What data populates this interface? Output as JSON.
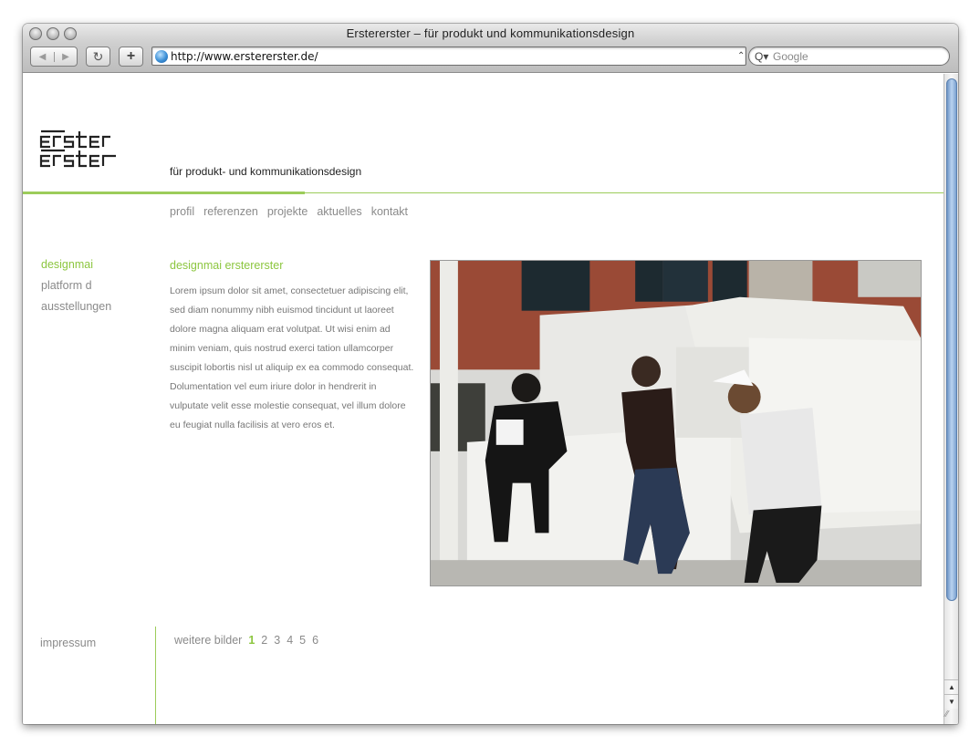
{
  "browser": {
    "window_title": "Erstererster – für produkt und kommunikationsdesign",
    "url": "http://www.erstererster.de/",
    "search_placeholder": "Google",
    "back_icon": "◀",
    "forward_icon": "▶",
    "reload_icon": "↻",
    "add_icon": "+",
    "search_icon": "Q▾",
    "url_menu_icon": "⌃",
    "scroll_up_icon": "▲",
    "scroll_down_icon": "▼",
    "resize_icon": "⁄⁄"
  },
  "header": {
    "tagline": "für produkt- und kommunikationsdesign"
  },
  "topnav": [
    "profil",
    "referenzen",
    "projekte",
    "aktuelles",
    "kontakt"
  ],
  "sidenav": [
    {
      "label": "designmai",
      "active": true
    },
    {
      "label": "platform d",
      "active": false
    },
    {
      "label": "ausstellungen",
      "active": false
    }
  ],
  "article": {
    "title": "designmai erstererster",
    "body": "Lorem ipsum dolor sit amet, consectetuer adipiscing elit, sed diam nonummy nibh euismod tincidunt ut laoreet dolore magna aliquam erat volutpat. Ut wisi enim ad minim veniam, quis nostrud exerci tation ullamcorper suscipit lobortis nisl ut aliquip ex ea commodo consequat. Dolumentation vel eum iriure dolor in hendrerit in vulputate velit esse molestie consequat, vel illum dolore eu feugiat nulla facilisis at vero eros et."
  },
  "footer": {
    "impressum": "impressum",
    "more_images_label": "weitere bilder",
    "pages": [
      "1",
      "2",
      "3",
      "4",
      "5",
      "6"
    ],
    "current_page": "1"
  },
  "colors": {
    "accent_green": "#8cc63f",
    "nav_gray": "#8a8a8a"
  }
}
